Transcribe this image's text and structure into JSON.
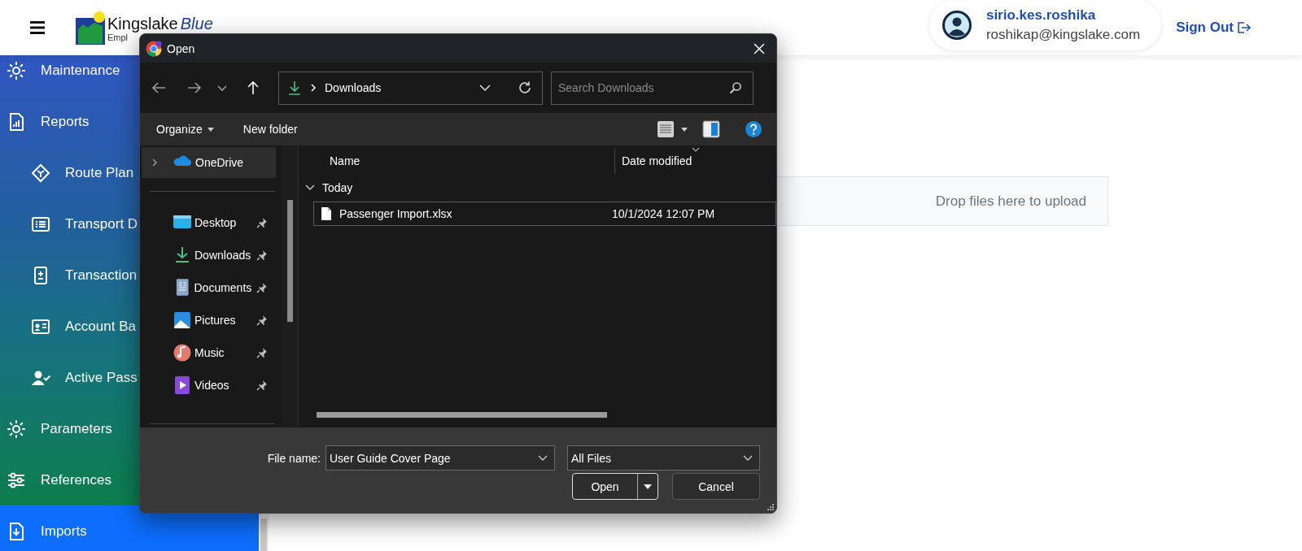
{
  "header": {
    "logo": {
      "name": "Kingslake",
      "accent": "Blue",
      "tagline": "Empl"
    },
    "user": {
      "name": "sirio.kes.roshika",
      "email": "roshikap@kingslake.com"
    },
    "sign_out": "Sign Out"
  },
  "sidebar": {
    "items": [
      {
        "label": "Maintenance",
        "selected": false
      },
      {
        "label": "Reports",
        "selected": false,
        "children": [
          {
            "label": "Route Plan",
            "selected": false
          },
          {
            "label": "Transport D",
            "selected": false
          },
          {
            "label": "Transaction",
            "selected": false
          },
          {
            "label": "Account Ba",
            "selected": false
          },
          {
            "label": "Active Pass",
            "selected": false
          }
        ]
      },
      {
        "label": "Parameters",
        "selected": false
      },
      {
        "label": "References",
        "selected": false
      },
      {
        "label": "Imports",
        "selected": true
      }
    ]
  },
  "upload": {
    "hint": "Drop files here to upload"
  },
  "dialog": {
    "title": "Open",
    "address": {
      "path": "Downloads"
    },
    "search": {
      "placeholder": "Search Downloads"
    },
    "toolbar": [
      "Organize",
      "New folder"
    ],
    "nav_pane": [
      {
        "label": "OneDrive",
        "kind": "root",
        "selected": true
      },
      {
        "label": "Desktop",
        "kind": "pinned",
        "selected": false
      },
      {
        "label": "Downloads",
        "kind": "pinned",
        "selected": false
      },
      {
        "label": "Documents",
        "kind": "pinned",
        "selected": false
      },
      {
        "label": "Pictures",
        "kind": "pinned",
        "selected": false
      },
      {
        "label": "Music",
        "kind": "pinned",
        "selected": false
      },
      {
        "label": "Videos",
        "kind": "pinned",
        "selected": false
      }
    ],
    "columns": [
      "Name",
      "Date modified"
    ],
    "groups": [
      {
        "label": "Today",
        "expanded": true,
        "files": [
          {
            "name": "Passenger Import.xlsx",
            "date": "10/1/2024 12:07 PM",
            "selected": false,
            "focused": true
          }
        ]
      }
    ],
    "file_name": {
      "label": "File name:",
      "value": "User Guide Cover Page"
    },
    "file_type": {
      "value": "All Files"
    },
    "buttons": [
      {
        "label": "Open",
        "kind": "split"
      },
      {
        "label": "Cancel",
        "kind": "plain"
      }
    ]
  }
}
